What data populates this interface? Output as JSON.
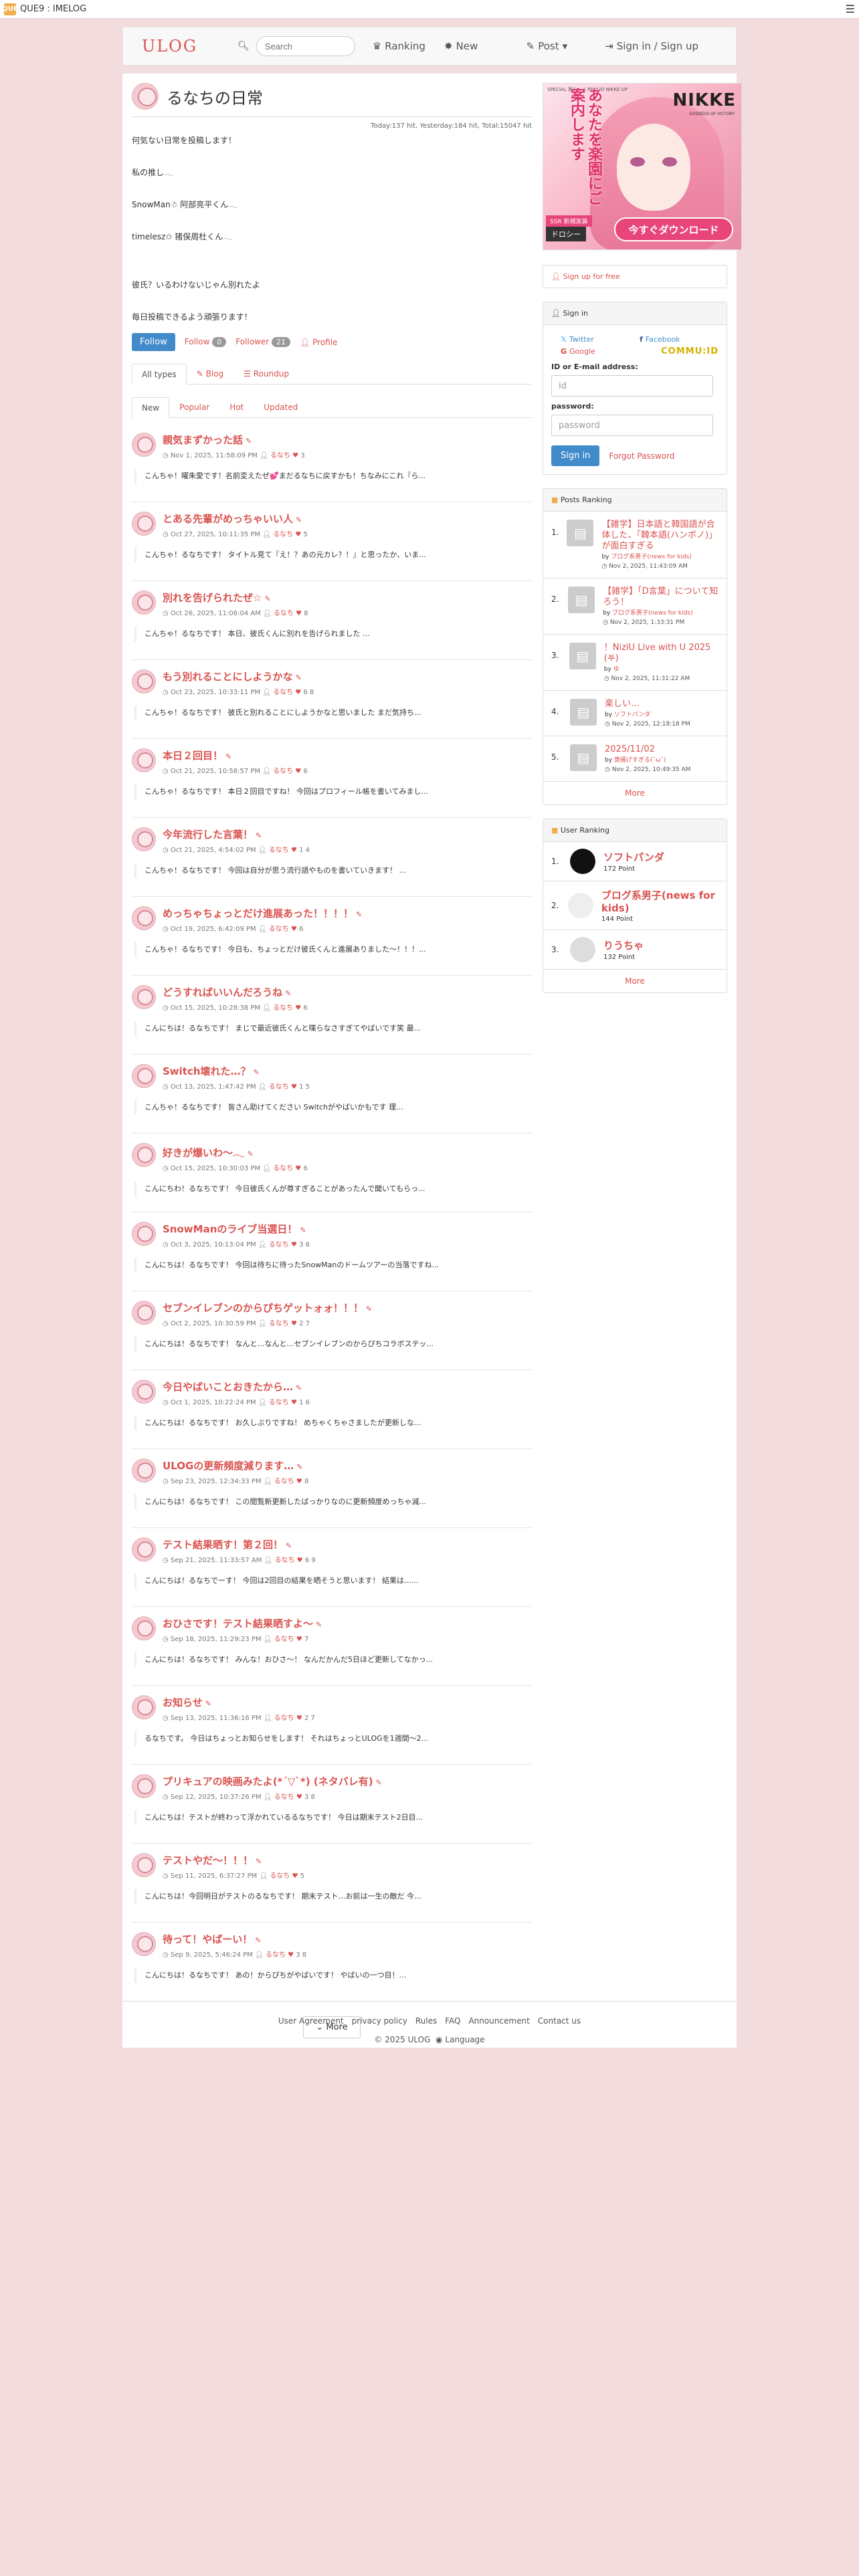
{
  "topbar": {
    "logo": "QUE",
    "title": "QUE9 : IMELOG",
    "menu_icon": "hamburger-icon"
  },
  "nav": {
    "brand": "ULOG",
    "search_placeholder": "Search",
    "ranking": "Ranking",
    "new": "New",
    "post": "Post",
    "signin": "Sign in / Sign up"
  },
  "profile": {
    "name": "るなちの日常",
    "hits": "Today:137 hit,  Yesterday:184 hit,  Total:15047 hit",
    "intro": [
      "何気ない日常を投稿します！",
      "",
      "私の推し𓂃",
      "",
      "SnowMan☃︎ 阿部亮平くん𓂃",
      "",
      "timelesz✩ 猪俣周杜くん𓂃",
      "",
      "",
      "彼氏？いるわけないじゃん別れたよ",
      "",
      "毎日投稿できるよう頑張ります！"
    ],
    "follow_btn": "Follow",
    "follow_label": "Follow",
    "follow_count": "0",
    "follower_label": "Follower",
    "follower_count": "21",
    "profile_link": "Profile"
  },
  "tabs": {
    "all": "All types",
    "blog": "Blog",
    "roundup": "Roundup"
  },
  "subtabs": {
    "new": "New",
    "popular": "Popular",
    "hot": "Hot",
    "updated": "Updated"
  },
  "posts": [
    {
      "title": "親気まずかった話",
      "meta": "Nov 1, 2025, 11:58:09 PM",
      "author": "るなち",
      "stats": "3",
      "body": "こんちゃ！曜朱愛です！名前変えたぜ💕まだるなちに戻すかも！ちなみにこれ『ら..."
    },
    {
      "title": "とある先輩がめっちゃいい人",
      "meta": "Oct 27, 2025, 10:11:35 PM",
      "author": "るなち",
      "stats": "5",
      "body": "こんちゃ！るなちです！ タイトル見て『え！？あの元カレ？！』と思ったか、いま..."
    },
    {
      "title": "別れを告げられたぜ☆",
      "meta": "Oct 26, 2025, 11:06:04 AM",
      "author": "るなち",
      "stats": "8",
      "body": "こんちゃ！るなちです！ 本日、彼氏くんに別れを告げられました ..."
    },
    {
      "title": "もう別れることにしようかな",
      "meta": "Oct 23, 2025, 10:33:11 PM",
      "author": "るなち",
      "stats": "6  8",
      "body": "こんちゃ！るなちです！ 彼氏と別れることにしようかなと思いました まだ気持ち..."
    },
    {
      "title": "本日２回目！",
      "meta": "Oct 21, 2025, 10:58:57 PM",
      "author": "るなち",
      "stats": "6",
      "body": "こんちゃ！るなちです！ 本日２回目ですね！ 今回はプロフィール帳を書いてみまし..."
    },
    {
      "title": "今年流行した言葉！",
      "meta": "Oct 21, 2025, 4:54:02 PM",
      "author": "るなち",
      "stats": "1  4",
      "body": "こんちゃ！るなちです！ 今回は自分が思う流行語やものを書いていきます！ ..."
    },
    {
      "title": "めっちゃちょっとだけ進展あった！！！！",
      "meta": "Oct 19, 2025, 6:42:09 PM",
      "author": "るなち",
      "stats": "6",
      "body": "こんちゃ！るなちです！ 今日も、ちょっとだけ彼氏くんと進展ありました〜！！！..."
    },
    {
      "title": "どうすればいいんだろうね",
      "meta": "Oct 15, 2025, 10:28:38 PM",
      "author": "るなち",
      "stats": "6",
      "body": "こんにちは！るなちです！ まじで最近彼氏くんと喋らなさすぎてやばいです笑 最..."
    },
    {
      "title": "Switch壊れた…？",
      "meta": "Oct 13, 2025, 1:47:42 PM",
      "author": "るなち",
      "stats": "1  5",
      "body": "こんちゃ！るなちです！ 皆さん助けてください Switchがやばいかもです 理..."
    },
    {
      "title": "好きが爆いわ〜𓂃",
      "meta": "Oct 15, 2025, 10:30:03 PM",
      "author": "るなち",
      "stats": "6",
      "body": "こんにちわ！るなちです！ 今日彼氏くんが尊すぎることがあったんで聞いてもらっ..."
    },
    {
      "title": "SnowManのライブ当選日！",
      "meta": "Oct 3, 2025, 10:13:04 PM",
      "author": "るなち",
      "stats": "3  6",
      "body": "こんにちは！るなちです！ 今回は待ちに待ったSnowManのドームツアーの当落ですね..."
    },
    {
      "title": "セブンイレブンのからぴちゲットォォ！！！",
      "meta": "Oct 2, 2025, 10:30:59 PM",
      "author": "るなち",
      "stats": "2  7",
      "body": "こんにちは！るなちです！ なんと…なんと…セブンイレブンのからぴちコラボステッ..."
    },
    {
      "title": "今日やばいことおきたから…",
      "meta": "Oct 1, 2025, 10:22:24 PM",
      "author": "るなち",
      "stats": "1  6",
      "body": "こんにちは！るなちです！ お久しぶりですね！ めちゃくちゃさましたが更新しな..."
    },
    {
      "title": "ULOGの更新頻度減ります…",
      "meta": "Sep 23, 2025, 12:34:33 PM",
      "author": "るなち",
      "stats": "8",
      "body": "こんにちは！るなちです！ この閲覧新更新したばっかりなのに更新頻度めっちゃ減..."
    },
    {
      "title": "テスト結果晒す！第２回！",
      "meta": "Sep 21, 2025, 11:33:57 AM",
      "author": "るなち",
      "stats": "6  9",
      "body": "こんにちは！るなちでーす！ 今回は2回目の結果を晒そうと思います！ 結果は…..."
    },
    {
      "title": "おひさです！テスト結果晒すよ〜",
      "meta": "Sep 18, 2025, 11:29:23 PM",
      "author": "るなち",
      "stats": "7",
      "body": "こんにちは！るなちです！ みんな！おひさ〜！ なんだかんだ5日ほど更新してなかっ..."
    },
    {
      "title": "お知らせ",
      "meta": "Sep 13, 2025, 11:36:16 PM",
      "author": "るなち",
      "stats": "2  7",
      "body": "るなちです。 今日はちょっとお知らせをします！ それはちょっとULOGを1週間〜2..."
    },
    {
      "title": "プリキュアの映画みたよ(*´▽`*) (ネタバレ有)",
      "meta": "Sep 12, 2025, 10:37:26 PM",
      "author": "るなち",
      "stats": "3  8",
      "body": "こんにちは！テストが終わって浮かれているるなちです！ 今日は期末テスト2日目..."
    },
    {
      "title": "テストやだ〜！！！",
      "meta": "Sep 11, 2025, 6:37:27 PM",
      "author": "るなち",
      "stats": "5",
      "body": "こんにちは！今回明日がテストのるなちです！ 期末テスト…お前は一生の敵だ 今..."
    },
    {
      "title": "待って！やばーい！",
      "meta": "Sep 9, 2025, 5:46:24 PM",
      "author": "るなち",
      "stats": "3  8",
      "body": "こんにちは！るなちです！ あの！からぴちがやばいです！ やばいの一つ目！..."
    }
  ],
  "more_btn": "More",
  "footer": {
    "links": [
      "User Agreement",
      "privacy policy",
      "Rules",
      "FAQ",
      "Announcement",
      "Contact us"
    ],
    "copy": "© 2025  ULOG",
    "language": "Language"
  },
  "ad": {
    "vertical_text": "あなたを楽園にご案内します",
    "nikke": "NIKKE",
    "nikke_sub": "GODDESS OF VICTORY",
    "top": "SPECIAL 第7 ★ A PROUD NIKKE UP",
    "tag": "SSR 新規実装",
    "name": "ドロシー",
    "download": "今すぐダウンロード"
  },
  "sidebar": {
    "signup": "Sign up for free",
    "signin_title": "Sign in",
    "twitter": "Twitter",
    "facebook": "Facebook",
    "google": "Google",
    "commuid": "COMMU:ID",
    "id_label": "ID or E-mail address:",
    "id_placeholder": "id",
    "pw_label": "password:",
    "pw_placeholder": "password",
    "signin_btn": "Sign in",
    "forgot": "Forgot Password",
    "posts_ranking_title": "Posts Ranking",
    "posts_ranking": [
      {
        "num": "1.",
        "title": "【雑学】日本語と韓国語が合体した、「韓本語(ハンボノ)」が面白すぎる",
        "by": "ブログ系男子(news for kids)",
        "date": "Nov 2, 2025, 11:43:09 AM"
      },
      {
        "num": "2.",
        "title": "【雑学】「D言葉」について知ろう！",
        "by": "ブログ系男子(news for kids)",
        "date": "Nov 2, 2025, 1:33:31 PM"
      },
      {
        "num": "3.",
        "title": "！NiziU Live with U 2025 (𖤐)",
        "by": "ゆ",
        "date": "Nov 2, 2025, 11:31:22 AM"
      },
      {
        "num": "4.",
        "title": "楽しい…",
        "by": "ソフトパンダ",
        "date": "Nov 2, 2025, 12:18:18 PM"
      },
      {
        "num": "5.",
        "title": "2025/11/02",
        "by": "唐揚げすぎる(˘ω˘)",
        "date": "Nov 2, 2025, 10:49:35 AM"
      }
    ],
    "posts_more": "More",
    "user_ranking_title": "User Ranking",
    "user_ranking": [
      {
        "num": "1.",
        "name": "ソフトパンダ",
        "point": "172 Point"
      },
      {
        "num": "2.",
        "name": "ブログ系男子(news for kids)",
        "point": "144 Point"
      },
      {
        "num": "3.",
        "name": "りうちゃ",
        "point": "132 Point"
      }
    ],
    "users_more": "More"
  }
}
